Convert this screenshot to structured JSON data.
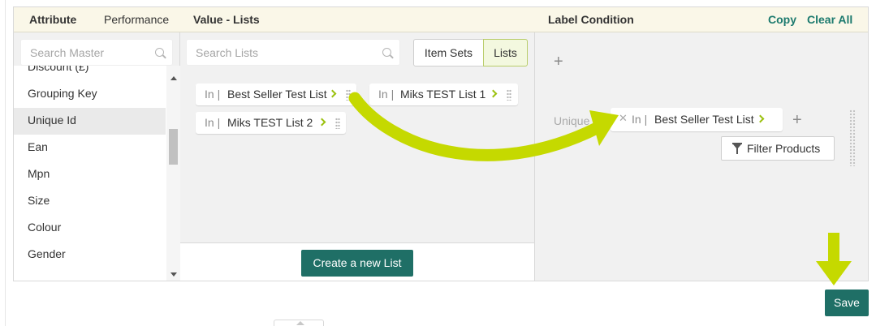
{
  "header": {
    "attribute_tab": "Attribute",
    "performance_tab": "Performance",
    "value_lists_title": "Value - Lists",
    "label_condition_title": "Label Condition",
    "copy_label": "Copy",
    "clear_all_label": "Clear All"
  },
  "master": {
    "search_placeholder": "Search Master",
    "items": [
      "Discount (£)",
      "Grouping Key",
      "Unique Id",
      "Ean",
      "Mpn",
      "Size",
      "Colour",
      "Gender"
    ],
    "selected": "Unique Id"
  },
  "lists_panel": {
    "search_placeholder": "Search Lists",
    "toggle_item_sets": "Item Sets",
    "toggle_lists": "Lists",
    "active_toggle": "Lists",
    "chips": [
      {
        "op": "In |",
        "name": "Best Seller Test List"
      },
      {
        "op": "In |",
        "name": "Miks TEST List 1"
      },
      {
        "op": "In |",
        "name": "Miks TEST List 2"
      }
    ],
    "create_button": "Create a new List"
  },
  "condition": {
    "field_label": "Unique",
    "chip": {
      "op": "In |",
      "name": "Best Seller Test List"
    },
    "filter_button": "Filter Products"
  },
  "save_button": "Save",
  "colors": {
    "accent_teal": "#1f6f66",
    "link_teal": "#1c7a6e",
    "chevron_green": "#9bc10f",
    "annotation_arrow": "#c5d900",
    "header_bg": "#faf7e8"
  },
  "icons": [
    "search-icon",
    "chevron-right-icon",
    "drag-handle-icon",
    "plus-icon",
    "close-icon",
    "filter-icon",
    "scroll-up-icon",
    "scroll-down-icon"
  ]
}
